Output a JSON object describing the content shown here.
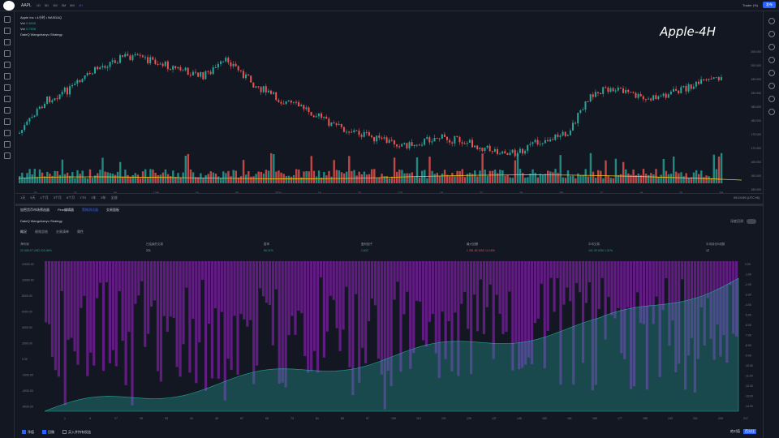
{
  "topbar": {
    "symbol": "AAPL",
    "timeframes": [
      "1D",
      "5D",
      "1M",
      "3M",
      "6M",
      "4H"
    ],
    "active_tf": "4H",
    "publish": "发布",
    "trader": "Trader (%)"
  },
  "legend": {
    "title": "Apple Inc • 4小时 • NASDAQ",
    "vol_label": "Vol",
    "vol1": "3.465K",
    "vol2": "3.735K",
    "strategy": "DateQ Wangchanyu Strategy"
  },
  "watermark": "Apple-4H",
  "price_axis": [
    "205.000",
    "200.000",
    "195.000",
    "190.000",
    "185.000",
    "180.000",
    "175.000",
    "170.000",
    "165.000",
    "160.000",
    "155.000"
  ],
  "time_axis": [
    "15",
    "22",
    "29",
    "12/5",
    "19",
    "26",
    "2024",
    "16",
    "23",
    "1/31",
    "15",
    "22",
    "29",
    "2/5",
    "12",
    "19",
    "26",
    "3/5"
  ],
  "rangebar": {
    "ranges": [
      "1天",
      "5天",
      "1个月",
      "3个月",
      "6个月",
      "YTD",
      "1年",
      "5年",
      "全部"
    ],
    "clock": "09:24:59 (UTC+8)",
    "rth": "RTH",
    "adj": "ADJ"
  },
  "panel_tabs": [
    "加密货币市场筛选器",
    "Pine编辑器",
    "策略测试器",
    "交易面板"
  ],
  "active_panel_tab": "策略测试器",
  "strategy_name": "DateQ Wangchanyu Strategy",
  "toggle_label": "深度回测",
  "subtabs": [
    "概况",
    "绩效总结",
    "交易清单",
    "属性"
  ],
  "metrics": [
    {
      "label": "净利润",
      "value": "22 406.47 USD  224.06%",
      "color": "green"
    },
    {
      "label": "已结束的交易",
      "value": "221",
      "color": "plain"
    },
    {
      "label": "胜率",
      "value": "56.11%",
      "color": "green"
    },
    {
      "label": "盈利因子",
      "value": "1.622",
      "color": "green"
    },
    {
      "label": "最大回撤",
      "value": "1 281.60 USD  14.15%",
      "color": "red"
    },
    {
      "label": "平均交易",
      "value": "101.39 USD  1.01%",
      "color": "green"
    },
    {
      "label": "平均持仓K线数",
      "value": "12",
      "color": "plain"
    }
  ],
  "perf_yaxis": [
    "12000.00",
    "10000.00",
    "8000.00",
    "6000.00",
    "4000.00",
    "2000.00",
    "0.00",
    "-2000.00",
    "-4000.00",
    "-6000.00"
  ],
  "perf_right_axis": [
    "0.00",
    "-1.00",
    "-2.00",
    "-3.00",
    "-4.00",
    "-5.00",
    "-6.00",
    "-7.00",
    "-8.00",
    "-9.00",
    "-10.00",
    "-11.00",
    "-12.00",
    "-13.00",
    "-14.00"
  ],
  "perf_xaxis": [
    "1",
    "9",
    "17",
    "25",
    "33",
    "41",
    "49",
    "57",
    "65",
    "73",
    "81",
    "89",
    "97",
    "105",
    "113",
    "121",
    "129",
    "137",
    "145",
    "153",
    "161",
    "169",
    "177",
    "185",
    "193",
    "201",
    "209",
    "217"
  ],
  "bottombar": {
    "equity": "净值",
    "drawdown": "回撤",
    "buyhold": "买入并持有权益",
    "abs": "绝对值",
    "pct": "百分比"
  },
  "colors": {
    "up": "#26a69a",
    "down": "#ef5350",
    "accent": "#2962ff",
    "purple": "#7b1fa2",
    "equity": "#26a69a"
  }
}
